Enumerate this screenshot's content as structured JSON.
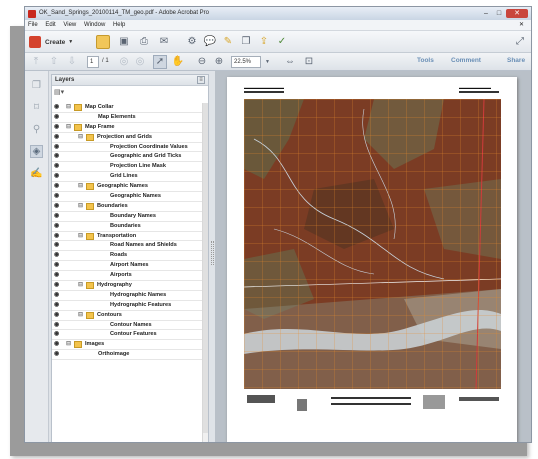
{
  "window": {
    "title": "OK_Sand_Springs_20100114_TM_geo.pdf - Adobe Acrobat Pro"
  },
  "menu": [
    "File",
    "Edit",
    "View",
    "Window",
    "Help"
  ],
  "toolbar": {
    "create_label": "Create",
    "page_current": "1",
    "page_total": "/ 1",
    "zoom": "22.5%",
    "tools_label": "Tools",
    "comment_label": "Comment",
    "share_label": "Share"
  },
  "layers_panel": {
    "title": "Layers",
    "items": [
      {
        "label": "Map Collar",
        "level": 0,
        "folder": true
      },
      {
        "label": "Map Elements",
        "level": 1,
        "folder": false
      },
      {
        "label": "Map Frame",
        "level": 0,
        "folder": true
      },
      {
        "label": "Projection and Grids",
        "level": 1,
        "folder": true
      },
      {
        "label": "Projection Coordinate Values",
        "level": 2,
        "folder": false
      },
      {
        "label": "Geographic and Grid Ticks",
        "level": 2,
        "folder": false
      },
      {
        "label": "Projection Line Mask",
        "level": 2,
        "folder": false
      },
      {
        "label": "Grid Lines",
        "level": 2,
        "folder": false
      },
      {
        "label": "Geographic Names",
        "level": 1,
        "folder": true
      },
      {
        "label": "Geographic Names",
        "level": 2,
        "folder": false
      },
      {
        "label": "Boundaries",
        "level": 1,
        "folder": true
      },
      {
        "label": "Boundary Names",
        "level": 2,
        "folder": false
      },
      {
        "label": "Boundaries",
        "level": 2,
        "folder": false
      },
      {
        "label": "Transportation",
        "level": 1,
        "folder": true
      },
      {
        "label": "Road Names and Shields",
        "level": 2,
        "folder": false
      },
      {
        "label": "Roads",
        "level": 2,
        "folder": false
      },
      {
        "label": "Airport Names",
        "level": 2,
        "folder": false
      },
      {
        "label": "Airports",
        "level": 2,
        "folder": false
      },
      {
        "label": "Hydrography",
        "level": 1,
        "folder": true
      },
      {
        "label": "Hydrographic Names",
        "level": 2,
        "folder": false
      },
      {
        "label": "Hydrographic Features",
        "level": 2,
        "folder": false
      },
      {
        "label": "Contours",
        "level": 1,
        "folder": true
      },
      {
        "label": "Contour Names",
        "level": 2,
        "folder": false
      },
      {
        "label": "Contour Features",
        "level": 2,
        "folder": false
      },
      {
        "label": "Images",
        "level": 0,
        "folder": true
      },
      {
        "label": "Orthoimage",
        "level": 1,
        "folder": false
      }
    ]
  }
}
